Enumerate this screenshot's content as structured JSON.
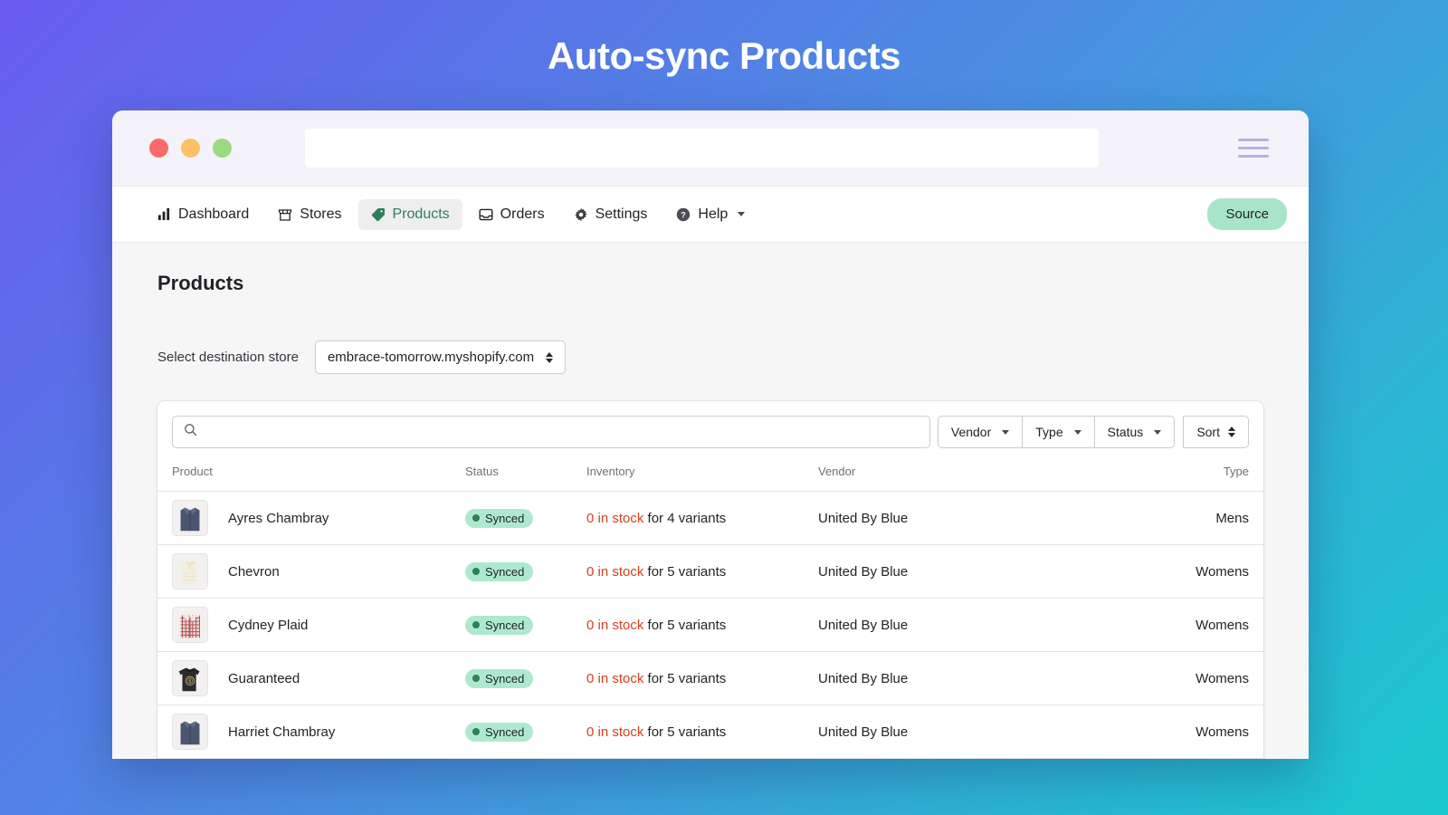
{
  "hero": {
    "title": "Auto-sync Products"
  },
  "browser": {
    "traffic_lights": [
      "close",
      "minimize",
      "maximize"
    ],
    "url_value": "",
    "url_placeholder": "",
    "menu_icon": "hamburger-menu-icon"
  },
  "nav": {
    "items": [
      {
        "label": "Dashboard",
        "icon": "bar-chart-icon",
        "active": false,
        "caret": false
      },
      {
        "label": "Stores",
        "icon": "storefront-icon",
        "active": false,
        "caret": false
      },
      {
        "label": "Products",
        "icon": "tag-icon",
        "active": true,
        "caret": false
      },
      {
        "label": "Orders",
        "icon": "inbox-icon",
        "active": false,
        "caret": false
      },
      {
        "label": "Settings",
        "icon": "gear-icon",
        "active": false,
        "caret": false
      },
      {
        "label": "Help",
        "icon": "question-circle-icon",
        "active": false,
        "caret": true
      }
    ],
    "source_button": "Source"
  },
  "page": {
    "title": "Products",
    "destination": {
      "label": "Select destination store",
      "selected": "embrace-tomorrow.myshopify.com"
    }
  },
  "filters": {
    "search_value": "",
    "search_placeholder": "",
    "search_icon": "search-icon",
    "buttons": [
      {
        "label": "Vendor",
        "control": "caret"
      },
      {
        "label": "Type",
        "control": "caret"
      },
      {
        "label": "Status",
        "control": "caret"
      },
      {
        "label": "Sort",
        "control": "updown"
      }
    ]
  },
  "table": {
    "columns": [
      "Product",
      "Status",
      "Inventory",
      "Vendor",
      "Type"
    ],
    "rows": [
      {
        "product": "Ayres Chambray",
        "thumb": "navy-chambray-shirt",
        "status": "Synced",
        "inventory_stock": "0 in stock",
        "inventory_rest": "for 4 variants",
        "vendor": "United By Blue",
        "type": "Mens"
      },
      {
        "product": "Chevron",
        "thumb": "cream-tee",
        "status": "Synced",
        "inventory_stock": "0 in stock",
        "inventory_rest": "for 5 variants",
        "vendor": "United By Blue",
        "type": "Womens"
      },
      {
        "product": "Cydney Plaid",
        "thumb": "red-plaid-shirt",
        "status": "Synced",
        "inventory_stock": "0 in stock",
        "inventory_rest": "for 5 variants",
        "vendor": "United By Blue",
        "type": "Womens"
      },
      {
        "product": "Guaranteed",
        "thumb": "black-graphic-tee",
        "status": "Synced",
        "inventory_stock": "0 in stock",
        "inventory_rest": "for 5 variants",
        "vendor": "United By Blue",
        "type": "Womens"
      },
      {
        "product": "Harriet Chambray",
        "thumb": "navy-chambray-shirt",
        "status": "Synced",
        "inventory_stock": "0 in stock",
        "inventory_rest": "for 5 variants",
        "vendor": "United By Blue",
        "type": "Womens"
      }
    ]
  },
  "colors": {
    "accent_green": "#2f7f5b",
    "badge_green": "#aee9cf",
    "source_green": "#a8e5c8",
    "danger_red": "#d5401f",
    "gradient_start": "#6a5cf0",
    "gradient_end": "#1ac8cf"
  }
}
